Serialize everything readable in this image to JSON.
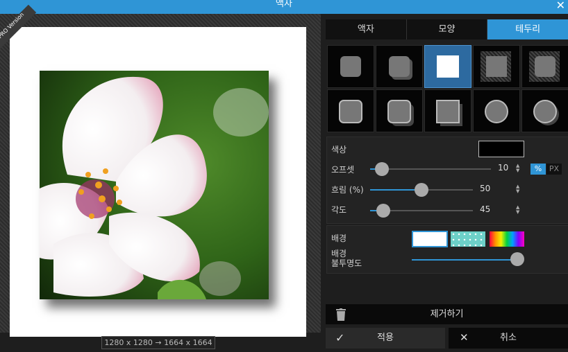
{
  "window": {
    "title": "액자",
    "close_icon": "close-icon"
  },
  "preview": {
    "ribbon_text": "PRO Version",
    "size_info": "1280 x 1280 → 1664 x 1664"
  },
  "tabs": [
    {
      "label": "액자",
      "active": false
    },
    {
      "label": "모양",
      "active": false
    },
    {
      "label": "테두리",
      "active": true
    }
  ],
  "style_grid": {
    "selected_index": 2,
    "styles": [
      "rounded-square",
      "rounded-square-shadow",
      "square-white",
      "square-frame",
      "rounded-frame",
      "rounded-outline",
      "rounded-outline-shadow",
      "square-outline-shadow",
      "circle-outline",
      "circle-outline-shadow"
    ]
  },
  "settings": {
    "color_label": "색상",
    "color_value": "#000000",
    "offset_label": "오프셋",
    "offset_value": "10",
    "offset_fraction": 0.1,
    "unit_percent": "%",
    "unit_px": "PX",
    "blur_label": "흐림 (%)",
    "blur_value": "50",
    "blur_fraction": 0.5,
    "angle_label": "각도",
    "angle_value": "45",
    "angle_fraction": 0.125
  },
  "background": {
    "label": "배경",
    "opacity_label_line1": "배경",
    "opacity_label_line2": "불투명도",
    "opacity_fraction": 1.0
  },
  "actions": {
    "remove_label": "제거하기",
    "apply_label": "적용",
    "cancel_label": "취소"
  },
  "colors": {
    "accent": "#2f95d6"
  }
}
